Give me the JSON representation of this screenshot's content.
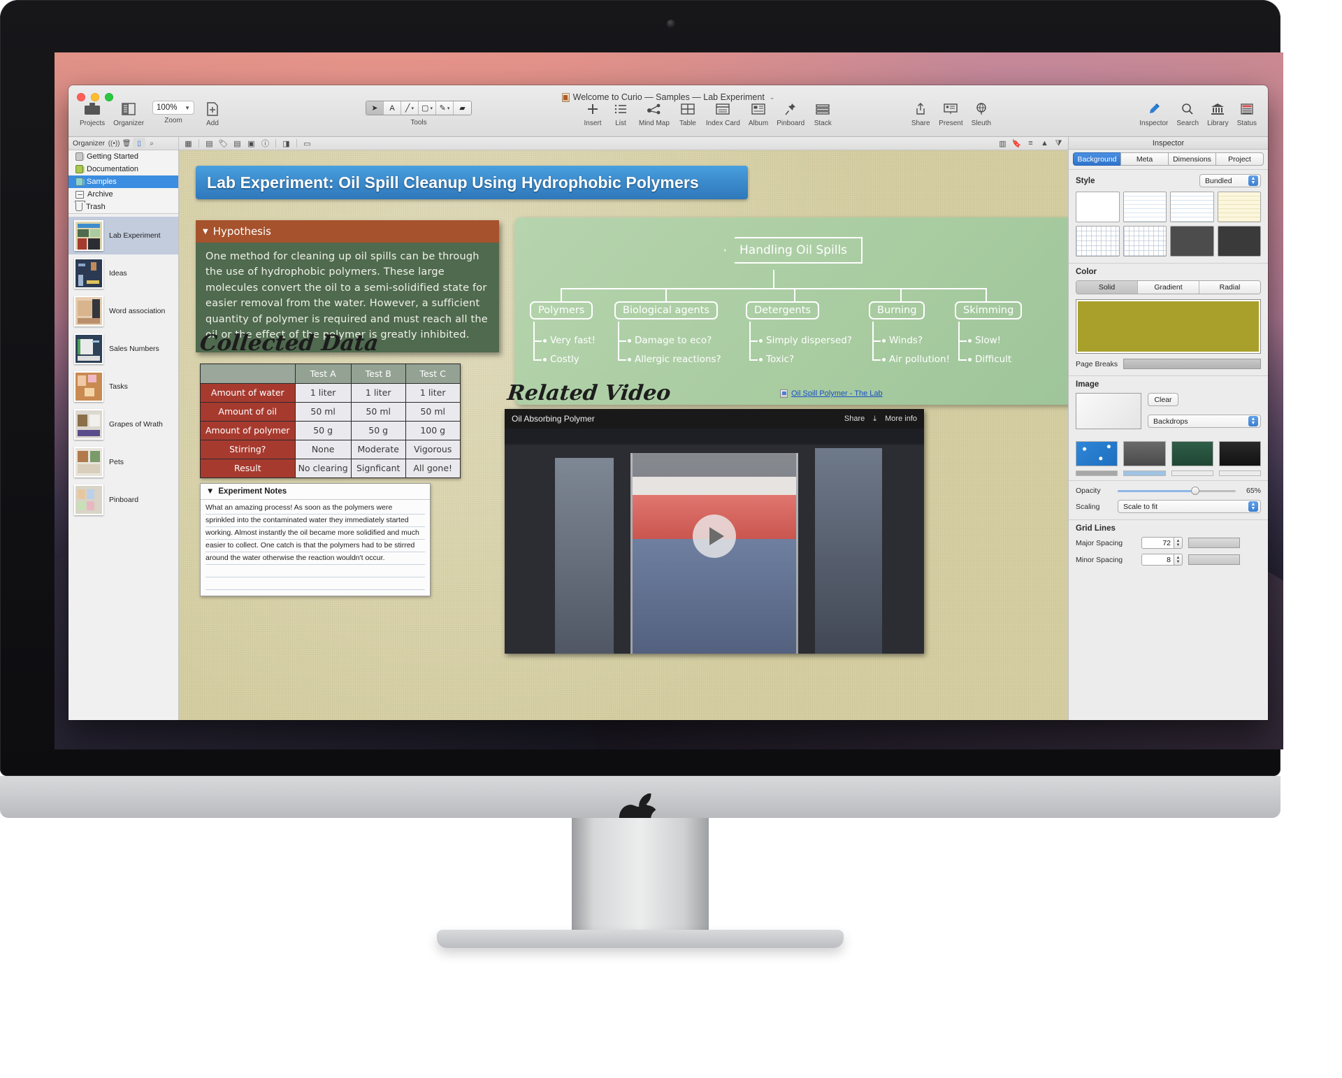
{
  "window": {
    "doc_title": "Welcome to Curio — Samples — Lab Experiment",
    "title_chevron": "⌄"
  },
  "toolbar": {
    "left": [
      {
        "label": "Projects",
        "icon": "projects-icon"
      },
      {
        "label": "Organizer",
        "icon": "organizer-icon"
      }
    ],
    "zoom": {
      "label": "Zoom",
      "value": "100%"
    },
    "add": {
      "label": "Add",
      "icon": "add-icon"
    },
    "tools_label": "Tools",
    "tools": [
      {
        "name": "select-arrow-tool",
        "glyph": "➤"
      },
      {
        "name": "text-tool",
        "glyph": "A"
      },
      {
        "name": "line-tool",
        "glyph": "╱"
      },
      {
        "name": "shape-tool",
        "glyph": "▢"
      },
      {
        "name": "pen-tool",
        "glyph": "✎"
      },
      {
        "name": "eraser-tool",
        "glyph": "▰"
      }
    ],
    "insert": [
      {
        "label": "Insert",
        "icon": "plus-icon"
      },
      {
        "label": "List",
        "icon": "list-icon"
      },
      {
        "label": "Mind Map",
        "icon": "mindmap-icon"
      },
      {
        "label": "Table",
        "icon": "table-icon"
      },
      {
        "label": "Index Card",
        "icon": "index-card-icon"
      },
      {
        "label": "Album",
        "icon": "album-icon"
      },
      {
        "label": "Pinboard",
        "icon": "pin-icon"
      },
      {
        "label": "Stack",
        "icon": "stack-icon"
      }
    ],
    "share_group": [
      {
        "label": "Share",
        "icon": "share-icon"
      },
      {
        "label": "Present",
        "icon": "present-icon"
      },
      {
        "label": "Sleuth",
        "icon": "sleuth-icon"
      }
    ],
    "far_group": [
      {
        "label": "Inspector",
        "icon": "inspector-icon"
      },
      {
        "label": "Search",
        "icon": "search-icon"
      },
      {
        "label": "Library",
        "icon": "library-icon"
      },
      {
        "label": "Status",
        "icon": "status-icon"
      }
    ]
  },
  "organizer": {
    "title": "Organizer",
    "bar_icons": [
      "broadcast-icon",
      "trash-icon",
      "new-idea-space-icon",
      "search-icon"
    ],
    "sources": [
      {
        "label": "Getting Started",
        "color": "grey"
      },
      {
        "label": "Documentation",
        "color": "green"
      },
      {
        "label": "Samples",
        "color": "teal",
        "selected": true
      },
      {
        "label": "Archive",
        "icon": "archive-icon"
      },
      {
        "label": "Trash",
        "icon": "trash-icon"
      }
    ],
    "ideas": [
      {
        "label": "Lab Experiment",
        "selected": true
      },
      {
        "label": "Ideas",
        "selected": false
      },
      {
        "label": "Word association",
        "selected": false
      },
      {
        "label": "Sales Numbers",
        "selected": false
      },
      {
        "label": "Tasks",
        "selected": false
      },
      {
        "label": "Grapes of Wrath",
        "selected": false
      },
      {
        "label": "Pets",
        "selected": false
      },
      {
        "label": "Pinboard",
        "selected": false
      }
    ]
  },
  "canvas_bar": {
    "left_icons": [
      "grid-view-icon",
      "table-icon",
      "tag-icon",
      "notes-icon",
      "index-card-icon",
      "info-icon",
      "flashcard-icon",
      "briefcase-icon"
    ],
    "right_icons": [
      "split-view-icon",
      "bookmark-icon",
      "align-icon",
      "collapse-icon",
      "filter-icon"
    ]
  },
  "canvas": {
    "banner_title": "Lab Experiment: Oil Spill Cleanup Using Hydrophobic Polymers",
    "hypothesis": {
      "header": "Hypothesis",
      "disclosure": "▼",
      "body": "One method for cleaning up oil spills can be through the use of hydrophobic polymers. These large molecules convert the oil to a semi-solidified state for easier removal from the water. However, a sufficient quantity of polymer is required and must reach all the oil or the effect of the polymer is greatly inhibited."
    },
    "mindmap": {
      "root": "Handling Oil Spills",
      "branches": [
        {
          "label": "Polymers",
          "leaves": [
            "Very fast!",
            "Costly"
          ]
        },
        {
          "label": "Biological agents",
          "leaves": [
            "Damage to eco?",
            "Allergic reactions?"
          ]
        },
        {
          "label": "Detergents",
          "leaves": [
            "Simply dispersed?",
            "Toxic?"
          ]
        },
        {
          "label": "Burning",
          "leaves": [
            "Winds?",
            "Air pollution!"
          ]
        },
        {
          "label": "Skimming",
          "leaves": [
            "Slow!",
            "Difficult"
          ]
        }
      ]
    },
    "collected_data_title": "Collected Data",
    "related_video_title": "Related Video",
    "video_link": "Oil Spill Polymer - The Lab",
    "video": {
      "title": "Oil Absorbing Polymer",
      "share": "Share",
      "more_info": "More info",
      "play": "play-button"
    },
    "notes": {
      "header": "Experiment Notes",
      "disclosure": "▼",
      "lines": [
        "What an amazing process! As soon as the polymers were",
        "sprinkled into the contaminated water they immediately started",
        "working. Almost instantly the oil became more solidified and much",
        "easier to collect. One catch is that the polymers had to be stirred",
        "around the water otherwise the reaction wouldn't occur.",
        "",
        ""
      ]
    }
  },
  "chart_data": {
    "type": "table",
    "title": "Collected Data",
    "columns": [
      "",
      "Test A",
      "Test B",
      "Test C"
    ],
    "rows": [
      {
        "header": "Amount of water",
        "values": [
          "1 liter",
          "1 liter",
          "1 liter"
        ]
      },
      {
        "header": "Amount of oil",
        "values": [
          "50 ml",
          "50 ml",
          "50 ml"
        ]
      },
      {
        "header": "Amount of polymer",
        "values": [
          "50 g",
          "50 g",
          "100 g"
        ]
      },
      {
        "header": "Stirring?",
        "values": [
          "None",
          "Moderate",
          "Vigorous"
        ]
      },
      {
        "header": "Result",
        "values": [
          "No clearing",
          "Signficant",
          "All gone!"
        ]
      }
    ]
  },
  "inspector": {
    "title": "Inspector",
    "tabs": [
      {
        "label": "Background",
        "selected": true
      },
      {
        "label": "Meta",
        "selected": false
      },
      {
        "label": "Dimensions",
        "selected": false
      },
      {
        "label": "Project",
        "selected": false
      }
    ],
    "style": {
      "label": "Style",
      "value": "Bundled"
    },
    "color": {
      "label": "Color",
      "segments": [
        {
          "label": "Solid",
          "selected": true
        },
        {
          "label": "Gradient",
          "selected": false
        },
        {
          "label": "Radial",
          "selected": false
        }
      ],
      "swatch_hex": "#a9a02b"
    },
    "page_breaks": {
      "label": "Page Breaks"
    },
    "image": {
      "label": "Image",
      "clear_button": "Clear",
      "backdrops_popup": "Backdrops"
    },
    "opacity": {
      "label": "Opacity",
      "value": "65%"
    },
    "scaling": {
      "label": "Scaling",
      "value": "Scale to fit"
    },
    "grid_lines": {
      "label": "Grid Lines",
      "major": {
        "label": "Major Spacing",
        "value": "72"
      },
      "minor": {
        "label": "Minor Spacing",
        "value": "8"
      }
    }
  }
}
